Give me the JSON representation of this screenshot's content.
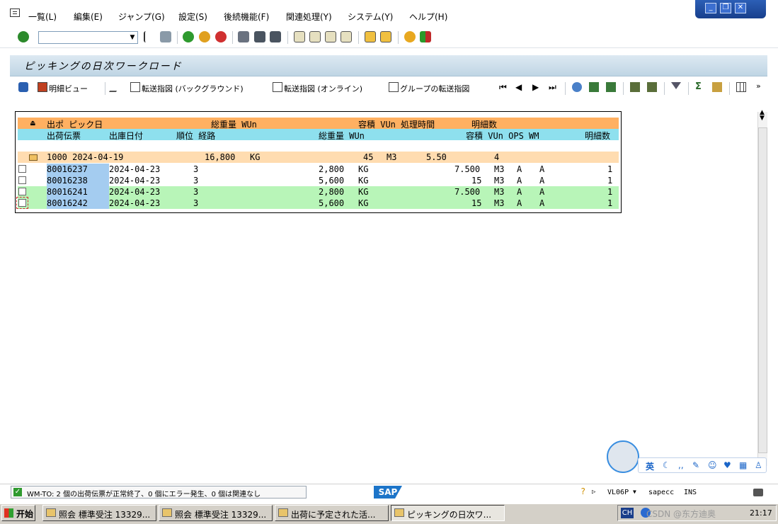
{
  "menu": [
    "一覧(L)",
    "編集(E)",
    "ジャンプ(G)",
    "設定(S)",
    "後続機能(F)",
    "関連処理(Y)",
    "システム(Y)",
    "ヘルプ(H)"
  ],
  "window_title": "ピッキングの日次ワークロード",
  "app_toolbar": {
    "detail_view": "明細ビュー",
    "transfer_background": "転送指図 (バックグラウンド)",
    "transfer_online": "転送指図 (オンライン)",
    "group_transfer": "グループの転送指図"
  },
  "grid": {
    "header1": {
      "c1": "出ポ ピック日",
      "c2": "総重量 WUn",
      "c3": "容積 VUn 処理時間",
      "c4": "明細数"
    },
    "header2": {
      "c1": "出荷伝票",
      "c2": "出庫日付",
      "c3": "順位 経路",
      "c4": "総重量 WUn",
      "c5": "容積 VUn OPS WM",
      "c6": "明細数"
    },
    "group": {
      "text": "1000 2024-04-19",
      "weight": "16,800",
      "wunit": "KG",
      "volume": "45",
      "vunit": "M3",
      "time": "5.50",
      "items": "4"
    },
    "rows": [
      {
        "doc": "80016237",
        "date": "2024-04-23",
        "rank": "3",
        "weight": "2,800",
        "wunit": "KG",
        "volume": "7.500",
        "vunit": "M3",
        "ops": "A",
        "wm": "A",
        "items": "1"
      },
      {
        "doc": "80016238",
        "date": "2024-04-23",
        "rank": "3",
        "weight": "5,600",
        "wunit": "KG",
        "volume": "15",
        "vunit": "M3",
        "ops": "A",
        "wm": "A",
        "items": "1"
      },
      {
        "doc": "80016241",
        "date": "2024-04-23",
        "rank": "3",
        "weight": "2,800",
        "wunit": "KG",
        "volume": "7.500",
        "vunit": "M3",
        "ops": "A",
        "wm": "A",
        "items": "1"
      },
      {
        "doc": "80016242",
        "date": "2024-04-23",
        "rank": "3",
        "weight": "5,600",
        "wunit": "KG",
        "volume": "15",
        "vunit": "M3",
        "ops": "A",
        "wm": "A",
        "items": "1"
      }
    ]
  },
  "status": {
    "message": "WM-TO: 2 個の出荷伝票が正常終了、0 個にエラー発生、0 個は関連なし",
    "transaction": "VL06P",
    "server": "sapecc",
    "mode": "INS"
  },
  "taskbar": {
    "start": "开始",
    "tasks": [
      "照会 標準受注 13329...",
      "照会 標準受注 13329...",
      "出荷に予定された活...",
      "ピッキングの日次ワ..."
    ],
    "lang": "CH",
    "clock": "21:17",
    "watermark": "CSDN @东方迪奥"
  },
  "ime": {
    "label": "英"
  },
  "colors": {
    "header1": "#ffb061",
    "header2": "#8ee0ee",
    "group": "#ffdcb0",
    "green_row": "#b8f5b8",
    "key_col": "#a4ccf0"
  }
}
